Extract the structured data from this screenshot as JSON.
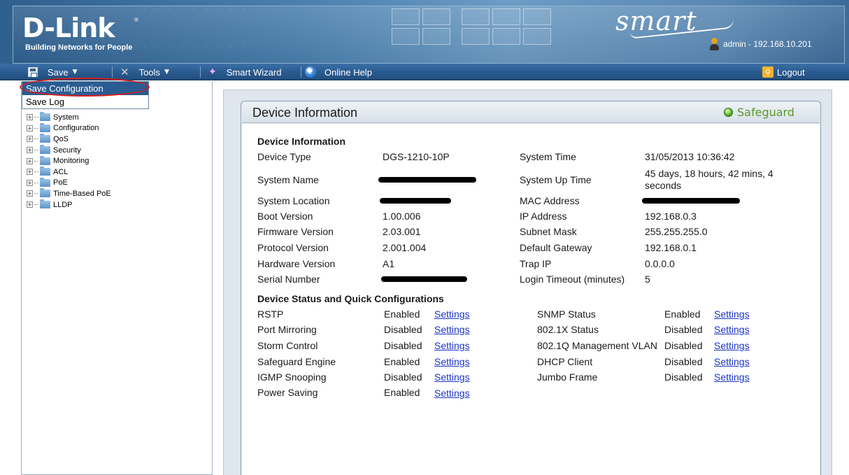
{
  "header": {
    "brand": "D-Link",
    "registered_mark": "®",
    "tagline": "Building Networks for People",
    "product_line": "Smart",
    "user_info": "admin - 192.168.10.201"
  },
  "menubar": {
    "save_label": "Save",
    "tools_label": "Tools",
    "wizard_label": "Smart Wizard",
    "help_label": "Online Help",
    "logout_label": "Logout"
  },
  "save_menu": {
    "items": [
      "Save Configuration",
      "Save Log"
    ],
    "selected": "Save Configuration"
  },
  "tree": {
    "items": [
      "System",
      "Configuration",
      "QoS",
      "Security",
      "Monitoring",
      "ACL",
      "PoE",
      "Time-Based PoE",
      "LLDP"
    ]
  },
  "panel": {
    "title": "Device Information",
    "safeguard_label": "Safeguard",
    "section_info_title": "Device Information",
    "left_info": [
      {
        "label": "Device Type",
        "value": "DGS-1210-10P"
      },
      {
        "label": "System Name",
        "value": "",
        "redacted": true
      },
      {
        "label": "System Location",
        "value": "",
        "redacted": true
      },
      {
        "label": "Boot Version",
        "value": "1.00.006"
      },
      {
        "label": "Firmware Version",
        "value": "2.03.001"
      },
      {
        "label": "Protocol Version",
        "value": "2.001.004"
      },
      {
        "label": "Hardware Version",
        "value": "A1"
      },
      {
        "label": "Serial Number",
        "value": "",
        "redacted": true
      }
    ],
    "right_info": [
      {
        "label": "System Time",
        "value": "31/05/2013 10:36:42"
      },
      {
        "label": "System Up Time",
        "value": "45 days, 18 hours, 42 mins, 4",
        "value2": "seconds"
      },
      {
        "label": "MAC Address",
        "value": "",
        "redacted": true
      },
      {
        "label": "IP Address",
        "value": "192.168.0.3"
      },
      {
        "label": "Subnet Mask",
        "value": "255.255.255.0"
      },
      {
        "label": "Default Gateway",
        "value": "192.168.0.1"
      },
      {
        "label": "Trap IP",
        "value": "0.0.0.0"
      },
      {
        "label": "Login Timeout (minutes)",
        "value": "5"
      }
    ],
    "section_status_title": "Device Status and Quick Configurations",
    "settings_link": "Settings",
    "left_status": [
      {
        "label": "RSTP",
        "state": "Enabled"
      },
      {
        "label": "Port Mirroring",
        "state": "Disabled"
      },
      {
        "label": "Storm Control",
        "state": "Disabled"
      },
      {
        "label": "Safeguard Engine",
        "state": "Enabled"
      },
      {
        "label": "IGMP Snooping",
        "state": "Disabled"
      },
      {
        "label": "Power Saving",
        "state": "Enabled"
      }
    ],
    "right_status": [
      {
        "label": "SNMP Status",
        "state": "Enabled"
      },
      {
        "label": "802.1X Status",
        "state": "Disabled"
      },
      {
        "label": "802.1Q Management VLAN",
        "state": "Disabled"
      },
      {
        "label": "DHCP Client",
        "state": "Disabled"
      },
      {
        "label": "Jumbo Frame",
        "state": "Disabled"
      }
    ]
  }
}
